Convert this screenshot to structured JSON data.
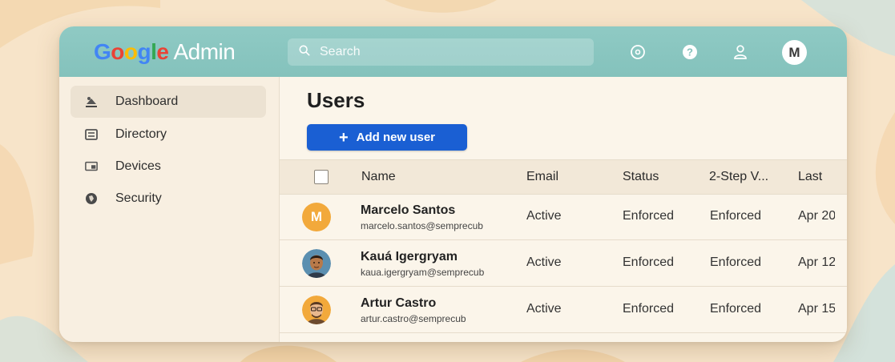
{
  "app": {
    "logo_parts": [
      "G",
      "o",
      "o",
      "g",
      "l",
      "e"
    ],
    "logo_suffix": "Admin"
  },
  "search": {
    "placeholder": "Search"
  },
  "topbar": {
    "icons": [
      "help-circle-icon",
      "question-icon",
      "account-icon"
    ],
    "avatar_letter": "M"
  },
  "sidebar": {
    "items": [
      {
        "label": "Dashboard",
        "icon": "dashboard-icon",
        "active": true
      },
      {
        "label": "Directory",
        "icon": "directory-icon",
        "active": false
      },
      {
        "label": "Devices",
        "icon": "devices-icon",
        "active": false
      },
      {
        "label": "Security",
        "icon": "security-icon",
        "active": false
      }
    ]
  },
  "main": {
    "title": "Users",
    "add_button": {
      "icon": "+",
      "label": "Add new user"
    },
    "table": {
      "columns": [
        "Name",
        "Email",
        "Status",
        "2-Step V...",
        "Last"
      ],
      "rows": [
        {
          "name": "Marcelo Santos",
          "email": "marcelo.santos@semprecub",
          "avatar_letter": "M",
          "email_col": "Active",
          "status": "Enforced",
          "two_step": "Enforced",
          "last": "Apr 20"
        },
        {
          "name": "Kauá Igergryam",
          "email": "kaua.igergryam@semprecub",
          "avatar_letter": "",
          "email_col": "Active",
          "status": "Enforced",
          "two_step": "Enforced",
          "last": "Apr 12."
        },
        {
          "name": "Artur Castro",
          "email": "artur.castro@semprecub",
          "avatar_letter": "",
          "email_col": "Active",
          "status": "Enforced",
          "two_step": "Enforced",
          "last": "Apr 15."
        }
      ]
    }
  },
  "colors": {
    "topbar": "#8fcac4",
    "primary_button": "#1a5fd3",
    "avatar_orange": "#f2a93b"
  }
}
